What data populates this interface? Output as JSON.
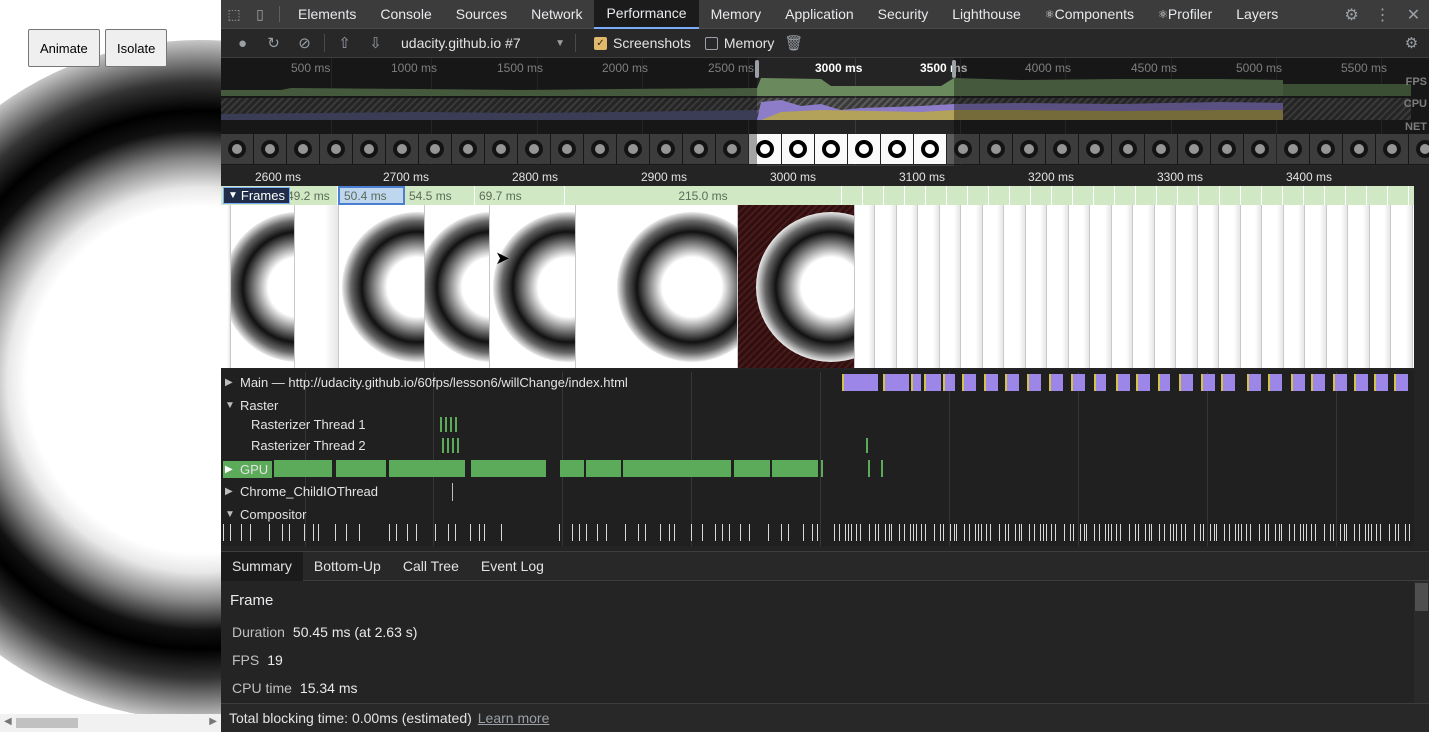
{
  "page": {
    "animate_label": "Animate",
    "isolate_label": "Isolate"
  },
  "devtools": {
    "tabs": [
      "Elements",
      "Console",
      "Sources",
      "Network",
      "Performance",
      "Memory",
      "Application",
      "Security",
      "Lighthouse",
      "Components",
      "Profiler",
      "Layers"
    ],
    "active_tab": "Performance",
    "tab_icons": {
      "Components": "atom-icon",
      "Profiler": "atom-icon"
    }
  },
  "perf_toolbar": {
    "recording": "udacity.github.io #7",
    "screenshots_label": "Screenshots",
    "screenshots_checked": true,
    "memory_label": "Memory",
    "memory_checked": false
  },
  "overview": {
    "ticks": [
      "500 ms",
      "1000 ms",
      "1500 ms",
      "2000 ms",
      "2500 ms",
      "3000 ms",
      "3500 ms",
      "4000 ms",
      "4500 ms",
      "5000 ms",
      "5500 ms"
    ],
    "labels": {
      "fps": "FPS",
      "cpu": "CPU",
      "net": "NET"
    }
  },
  "ruler": {
    "ticks": [
      "2600 ms",
      "2700 ms",
      "2800 ms",
      "2900 ms",
      "3000 ms",
      "3100 ms",
      "3200 ms",
      "3300 ms",
      "3400 ms"
    ]
  },
  "frames": {
    "label": "Frames",
    "cells": [
      "49.2 ms",
      "50.4 ms",
      "54.5 ms",
      "69.7 ms",
      "215.0 ms"
    ],
    "selected": "50.4 ms"
  },
  "tracks": {
    "main": "Main — http://udacity.github.io/60fps/lesson6/willChange/index.html",
    "raster": "Raster",
    "raster1": "Rasterizer Thread 1",
    "raster2": "Rasterizer Thread 2",
    "gpu": "GPU",
    "chrome_io": "Chrome_ChildIOThread",
    "compositor": "Compositor"
  },
  "bottom_tabs": [
    "Summary",
    "Bottom-Up",
    "Call Tree",
    "Event Log"
  ],
  "summary": {
    "title": "Frame",
    "duration_label": "Duration",
    "duration_value": "50.45 ms (at 2.63 s)",
    "fps_label": "FPS",
    "fps_value": "19",
    "cpu_label": "CPU time",
    "cpu_value": "15.34 ms"
  },
  "footer": {
    "text": "Total blocking time: 0.00ms (estimated)",
    "link": "Learn more"
  },
  "colors": {
    "accent": "#7cacf8",
    "gpu": "#5cab5a",
    "main": "#9c87e8",
    "frames": "#d0e9c4"
  }
}
